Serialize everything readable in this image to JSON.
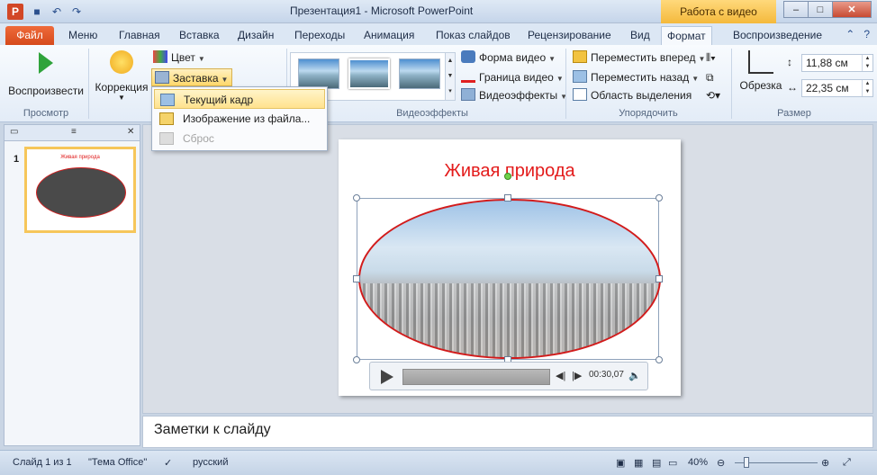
{
  "titlebar": {
    "app_icon_letter": "P",
    "title": "Презентация1 - Microsoft PowerPoint",
    "context_tab": "Работа с видео",
    "qat_icons": [
      "save-icon",
      "undo-icon",
      "redo-icon"
    ]
  },
  "tabs": [
    "Файл",
    "Меню",
    "Главная",
    "Вставка",
    "Дизайн",
    "Переходы",
    "Анимация",
    "Показ слайдов",
    "Рецензирование",
    "Вид",
    "Формат",
    "Воспроизведение"
  ],
  "active_tab": "Формат",
  "ribbon": {
    "groups": {
      "preview": "Просмотр",
      "effects": "Видеоэффекты",
      "arrange": "Упорядочить",
      "size": "Размер"
    },
    "play_label": "Воспроизвести",
    "correction_label": "Коррекция",
    "color_label": "Цвет",
    "poster_label": "Заставка",
    "video_shape": "Форма видео",
    "video_border": "Граница видео",
    "video_effects": "Видеоэффекты",
    "bring_forward": "Переместить вперед",
    "send_backward": "Переместить назад",
    "selection_pane": "Область выделения",
    "crop_label": "Обрезка",
    "height_value": "11,88 см",
    "width_value": "22,35 см"
  },
  "poster_menu": {
    "items": [
      {
        "label": "Текущий кадр",
        "highlighted": true,
        "disabled": false
      },
      {
        "label": "Изображение из файла...",
        "highlighted": false,
        "disabled": false
      },
      {
        "label": "Сброс",
        "highlighted": false,
        "disabled": true
      }
    ]
  },
  "slides_pane": {
    "slide_number": "1",
    "thumb_title": "Живая природа"
  },
  "slide": {
    "title": "Живая природа",
    "player_time": "00:30,07"
  },
  "notes": {
    "placeholder": "Заметки к слайду"
  },
  "status": {
    "slide_info": "Слайд 1 из 1",
    "theme": "\"Тема Office\"",
    "language": "русский",
    "zoom": "40%"
  },
  "colors": {
    "accent_file_tab": "#d64a1c",
    "title_red": "#e31b1b",
    "context_tab": "#f4b93c"
  }
}
